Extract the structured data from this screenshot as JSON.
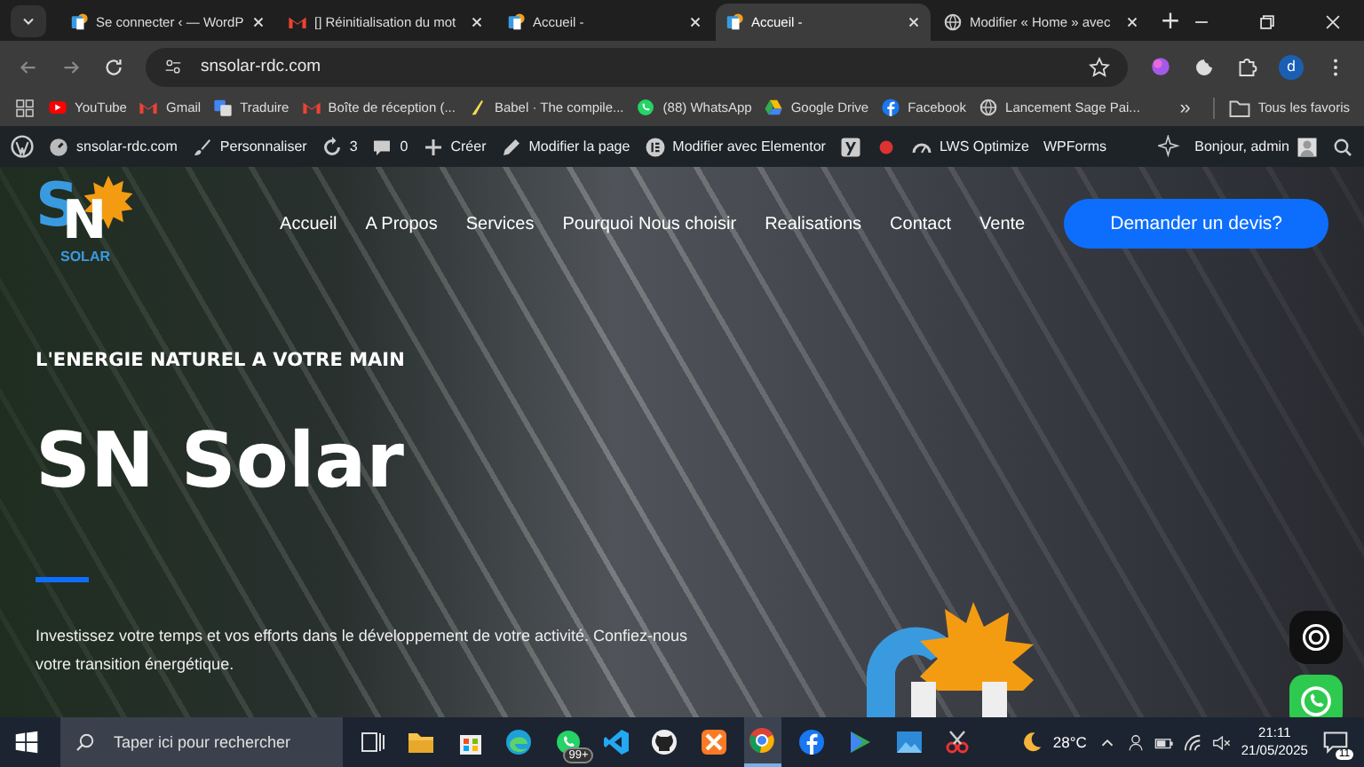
{
  "browser": {
    "tabs": [
      {
        "title": "Se connecter ‹ — WordP",
        "kind": "sn",
        "selected": false
      },
      {
        "title": "[] Réinitialisation du mot",
        "kind": "gmail",
        "selected": false
      },
      {
        "title": "Accueil -",
        "kind": "sn",
        "selected": false
      },
      {
        "title": "Accueil -",
        "kind": "sn",
        "selected": true
      },
      {
        "title": "Modifier « Home » avec",
        "kind": "globe",
        "selected": false
      }
    ],
    "new_tab": "+",
    "address": "snsolar-rdc.com",
    "profile_initial": "d",
    "bookmarks": [
      {
        "label": "YouTube",
        "kind": "youtube"
      },
      {
        "label": "Gmail",
        "kind": "gmail"
      },
      {
        "label": "Traduire",
        "kind": "translate"
      },
      {
        "label": "Boîte de réception (...",
        "kind": "gmail"
      },
      {
        "label": "Babel · The compile...",
        "kind": "babel"
      },
      {
        "label": "(88) WhatsApp",
        "kind": "whatsapp"
      },
      {
        "label": "Google Drive",
        "kind": "drive"
      },
      {
        "label": "Facebook",
        "kind": "facebook"
      },
      {
        "label": "Lancement Sage Pai...",
        "kind": "globe"
      }
    ],
    "more_bookmarks": "»",
    "all_bookmarks": "Tous les favoris"
  },
  "admin_bar": {
    "items": [
      {
        "label": "snsolar-rdc.com",
        "kind": "home"
      },
      {
        "label": "Personnaliser",
        "kind": "brush"
      },
      {
        "label": "3",
        "kind": "updates"
      },
      {
        "label": "0",
        "kind": "comments"
      },
      {
        "label": "Créer",
        "kind": "plus"
      },
      {
        "label": "Modifier la page",
        "kind": "pencil"
      },
      {
        "label": "Modifier avec Elementor",
        "kind": "elementor"
      },
      {
        "kind": "yoast"
      },
      {
        "kind": "dot"
      },
      {
        "label": "LWS Optimize",
        "kind": "gauge"
      },
      {
        "label": "WPForms",
        "kind": "none"
      }
    ],
    "greeting": "Bonjour, admin"
  },
  "site": {
    "logo": {
      "letter_1": "S",
      "letter_2": "N",
      "caption": "SOLAR"
    },
    "nav": [
      "Accueil",
      "A Propos",
      "Services",
      "Pourquoi Nous choisir",
      "Realisations",
      "Contact",
      "Vente"
    ],
    "cta": "Demander un devis?",
    "hero": {
      "eyebrow": "L'ENERGIE NATUREL A VOTRE MAIN",
      "title": "SN Solar",
      "text": "Investissez votre temps et vos efforts dans le développement de votre activité. Confiez-nous votre transition énergétique."
    }
  },
  "taskbar": {
    "search_placeholder": "Taper ici pour rechercher",
    "apps": [
      {
        "kind": "taskview",
        "selected": false
      },
      {
        "kind": "folder",
        "selected": false
      },
      {
        "kind": "store",
        "selected": false
      },
      {
        "kind": "edge",
        "selected": false
      },
      {
        "kind": "whatsapp",
        "selected": false,
        "badge": "99+"
      },
      {
        "kind": "vscode",
        "selected": false
      },
      {
        "kind": "github",
        "selected": false
      },
      {
        "kind": "xampp",
        "selected": false
      },
      {
        "kind": "chrome",
        "selected": true
      },
      {
        "kind": "facebook",
        "selected": false
      },
      {
        "kind": "play",
        "selected": false
      },
      {
        "kind": "photo",
        "selected": false
      },
      {
        "kind": "snip",
        "selected": false
      }
    ],
    "weather": "28°C",
    "time": "21:11",
    "date": "21/05/2025",
    "notifications": "11"
  }
}
